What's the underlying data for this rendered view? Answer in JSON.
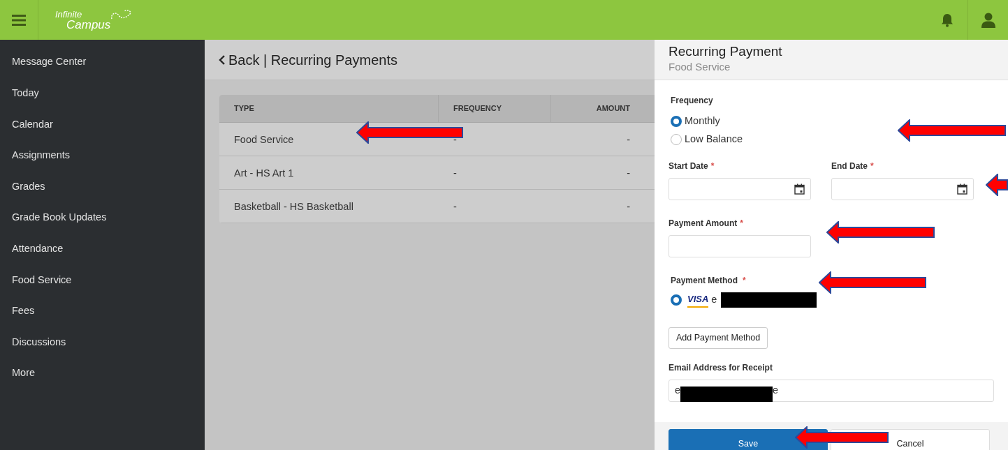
{
  "app": {
    "logo_top": "Infinite",
    "logo_bottom": "Campus"
  },
  "sidebar": {
    "items": [
      {
        "label": "Message Center"
      },
      {
        "label": "Today"
      },
      {
        "label": "Calendar"
      },
      {
        "label": "Assignments"
      },
      {
        "label": "Grades"
      },
      {
        "label": "Grade Book Updates"
      },
      {
        "label": "Attendance"
      },
      {
        "label": "Food Service"
      },
      {
        "label": "Fees"
      },
      {
        "label": "Discussions"
      },
      {
        "label": "More"
      }
    ]
  },
  "page_header": {
    "title": "Back | Recurring Payments"
  },
  "table": {
    "columns": [
      "TYPE",
      "FREQUENCY",
      "AMOUNT"
    ],
    "rows": [
      [
        "Food Service",
        "-",
        "-"
      ],
      [
        "Art - HS Art 1",
        "-",
        "-"
      ],
      [
        "Basketball - HS Basketball",
        "-",
        "-"
      ]
    ]
  },
  "panel": {
    "title": "Recurring Payment",
    "subtitle": "Food Service",
    "frequency": {
      "label": "Frequency",
      "options": [
        {
          "label": "Monthly",
          "selected": true
        },
        {
          "label": "Low Balance",
          "selected": false
        }
      ]
    },
    "start_date": {
      "label": "Start Date",
      "required_mark": "*"
    },
    "end_date": {
      "label": "End Date",
      "required_mark": "*"
    },
    "payment_amount": {
      "label": "Payment Amount",
      "required_mark": "*"
    },
    "payment_method": {
      "label": "Payment Method",
      "required_mark": "*",
      "options": [
        {
          "brand": "VISA",
          "label": "e",
          "selected": true
        }
      ]
    },
    "add_button": "Add Payment Method",
    "email": {
      "label": "Email Address for Receipt",
      "value_start": "e",
      "value_end": "e"
    },
    "buttons": [
      {
        "label": "Save",
        "kind": "primary"
      },
      {
        "label": "Cancel",
        "kind": "secondary"
      }
    ]
  }
}
